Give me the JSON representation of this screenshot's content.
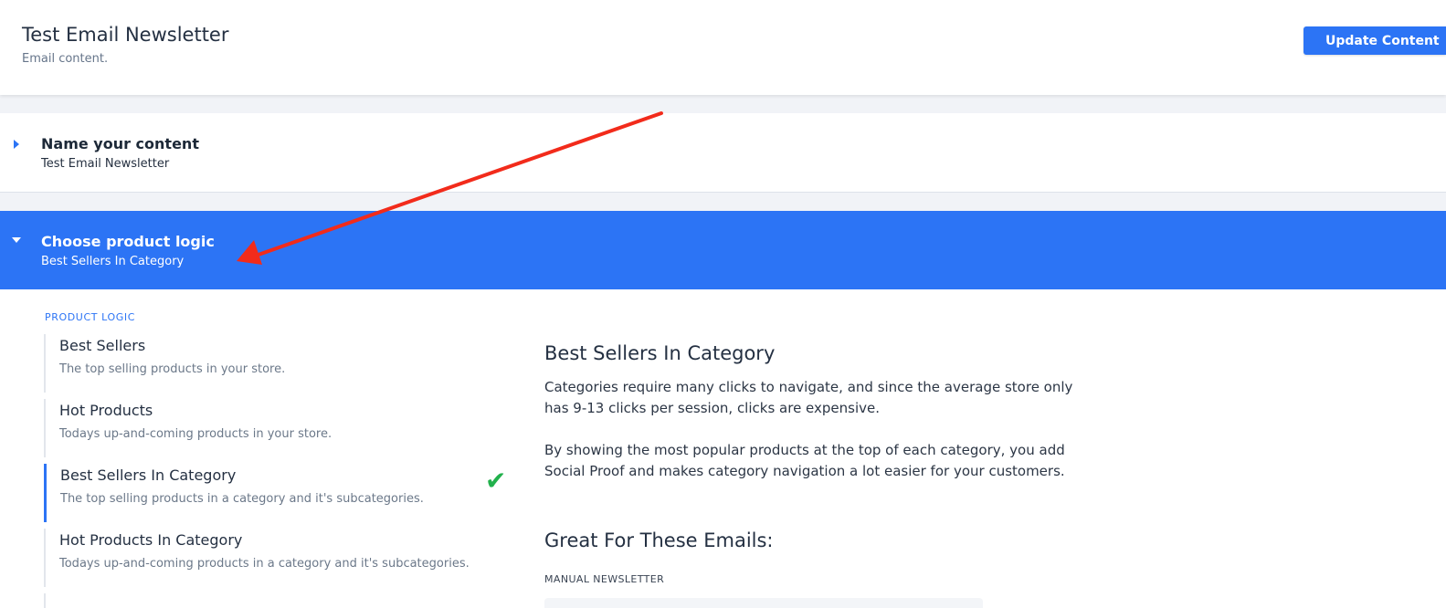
{
  "header": {
    "title": "Test Email Newsletter",
    "subtitle": "Email content.",
    "update_button": "Update Content"
  },
  "sections": {
    "name": {
      "title": "Name your content",
      "value": "Test Email Newsletter"
    },
    "logic": {
      "title": "Choose product logic",
      "value": "Best Sellers In Category"
    }
  },
  "product_logic": {
    "heading": "PRODUCT LOGIC",
    "items": [
      {
        "title": "Best Sellers",
        "desc": "The top selling products in your store."
      },
      {
        "title": "Hot Products",
        "desc": "Todays up-and-coming products in your store."
      },
      {
        "title": "Best Sellers In Category",
        "desc": "The top selling products in a category and it's subcategories.",
        "selected": true
      },
      {
        "title": "Hot Products In Category",
        "desc": "Todays up-and-coming products in a category and it's subcategories."
      }
    ],
    "selected_icon": "check-icon"
  },
  "detail": {
    "title": "Best Sellers In Category",
    "para1": "Categories require many clicks to navigate, and since the average store only has 9-13 clicks per session, clicks are expensive.",
    "para2": "By showing the most popular products at the top of each category, you add Social Proof and makes category navigation a lot easier for your customers.",
    "emails_title": "Great For These Emails:",
    "emails": [
      "MANUAL NEWSLETTER"
    ]
  },
  "colors": {
    "accent": "#2c74f5",
    "check": "#22b14c",
    "annotation": "#f22b1b"
  }
}
